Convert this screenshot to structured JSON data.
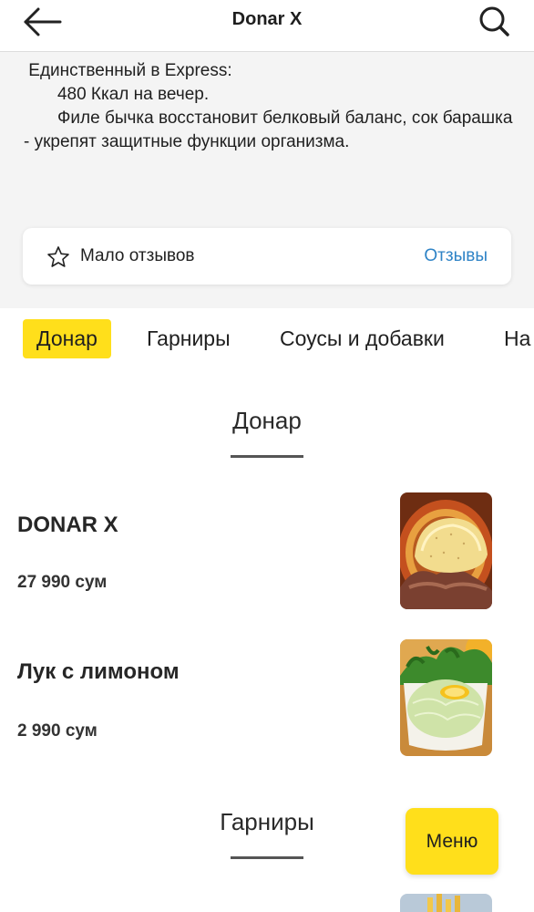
{
  "header": {
    "title": "Donar X",
    "back_icon": "arrow-left-icon",
    "search_icon": "search-icon"
  },
  "info": {
    "description": " Единственный в Express:\n       480 Ккал на вечер.\n       Филе бычка восстановит белковый баланс, сок барашка - укрепят защитные функции организма.",
    "review_status": "Мало отзывов",
    "reviews_link": "Отзывы",
    "star_icon": "star-outline-icon"
  },
  "tabs": [
    {
      "label": "Донар",
      "active": true
    },
    {
      "label": "Гарниры",
      "active": false
    },
    {
      "label": "Соусы и добавки",
      "active": false
    },
    {
      "label": "На",
      "active": false
    }
  ],
  "sections": [
    {
      "title": "Донар",
      "items": [
        {
          "name": "DONAR X",
          "price": "27 990 сум"
        },
        {
          "name": "Лук с лимоном",
          "price": "2 990 сум"
        }
      ]
    },
    {
      "title": "Гарниры",
      "items": []
    }
  ],
  "menu_button": "Меню",
  "colors": {
    "accent_yellow": "#ffdf1b",
    "link_blue": "#2e83c6",
    "info_background": "#f4f4f4"
  }
}
